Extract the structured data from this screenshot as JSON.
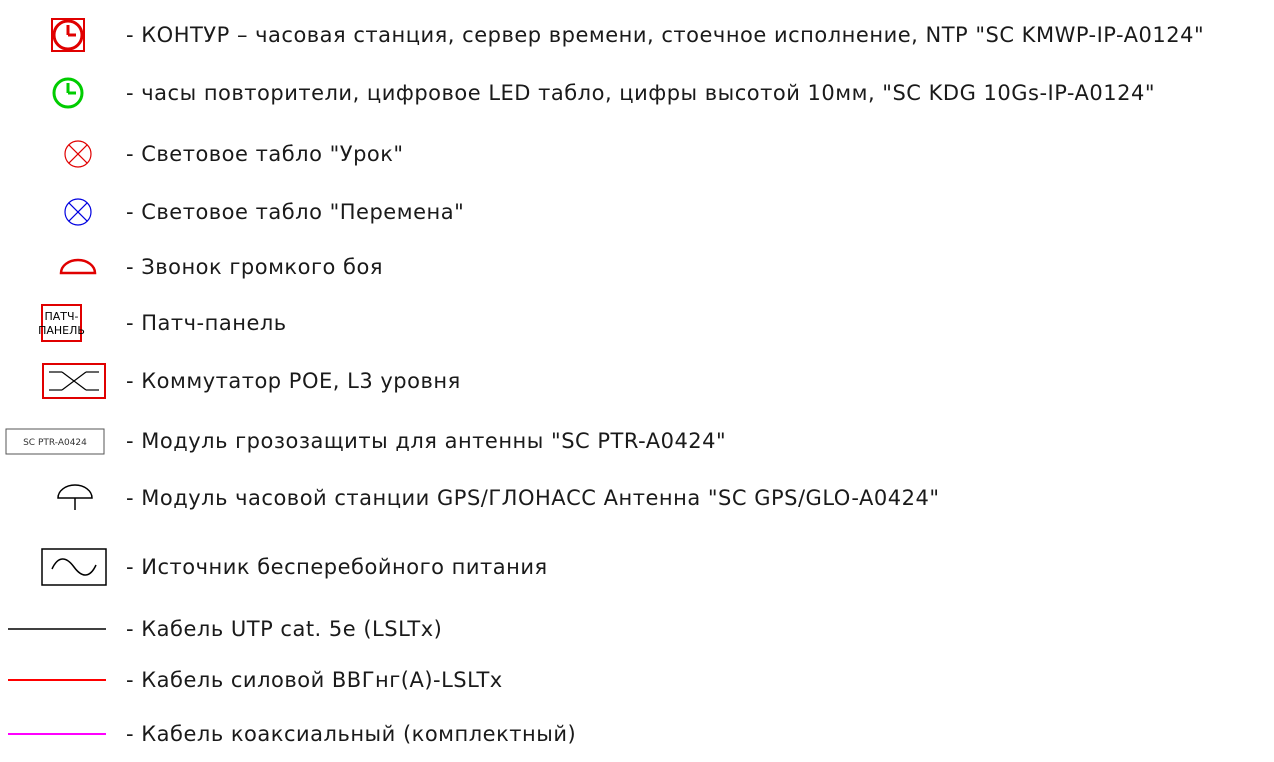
{
  "legend": {
    "items": [
      {
        "icon": "clock-station-icon",
        "color": "#e00000",
        "text": "- КОНТУР – часовая станция, сервер времени, стоечное исполнение, NTP \"SC KMWP-IP-A0124\""
      },
      {
        "icon": "clock-repeater-icon",
        "color": "#00cc00",
        "text": "- часы повторители, цифровое LED табло, цифры высотой 10мм, \"SC KDG 10Gs-IP-A0124\""
      },
      {
        "icon": "light-board-lesson-icon",
        "color": "#e00000",
        "text": "- Световое табло \"Урок\""
      },
      {
        "icon": "light-board-break-icon",
        "color": "#0000e0",
        "text": "- Световое табло \"Перемена\""
      },
      {
        "icon": "bell-icon",
        "color": "#e00000",
        "text": "- Звонок громкого боя"
      },
      {
        "icon": "patch-panel-icon",
        "color": "#e00000",
        "text": "- Патч-панель",
        "box_lines": [
          "ПАТЧ-",
          "ПАНЕЛЬ"
        ]
      },
      {
        "icon": "switch-icon",
        "color": "#e00000",
        "text": "- Коммутатор POE, L3 уровня"
      },
      {
        "icon": "surge-protector-icon",
        "color": "#000000",
        "text": "- Модуль грозозащиты для антенны \"SC PTR-A0424\"",
        "box_text": "SC PTR-A0424"
      },
      {
        "icon": "gps-antenna-icon",
        "color": "#000000",
        "text": "- Модуль часовой станции GPS/ГЛОНАСС Антенна \"SC GPS/GLO-A0424\""
      },
      {
        "icon": "ups-icon",
        "color": "#000000",
        "text": "- Источник бесперебойного питания"
      },
      {
        "icon": "cable-utp-line-icon",
        "color": "#000000",
        "text": "- Кабель UTP cat. 5e (LSLTx)"
      },
      {
        "icon": "cable-power-line-icon",
        "color": "#ff0000",
        "text": "- Кабель силовой ВВГнг(А)-LSLTx"
      },
      {
        "icon": "cable-coax-line-icon",
        "color": "#ff00ff",
        "text": "- Кабель коаксиальный (комплектный)"
      }
    ]
  }
}
